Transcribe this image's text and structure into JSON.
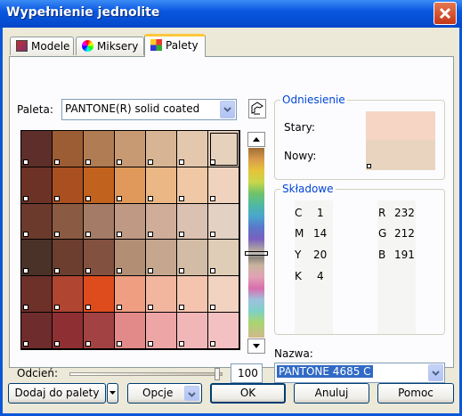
{
  "window": {
    "title": "Wypełnienie jednolite"
  },
  "tabs": [
    {
      "label": "Modele",
      "icon": "color-model-icon"
    },
    {
      "label": "Miksery",
      "icon": "color-wheel-icon"
    },
    {
      "label": "Palety",
      "icon": "palette-grid-icon",
      "active": true
    }
  ],
  "palette": {
    "label": "Paleta:",
    "selected": "PANTONE(R) solid coated"
  },
  "swatches": [
    [
      "#5e2f2a",
      "#9c5c34",
      "#b07c54",
      "#c89a74",
      "#d7b493",
      "#e3c8ad",
      "#e6d1bd"
    ],
    [
      "#6c3226",
      "#a94f20",
      "#c2621f",
      "#e0995a",
      "#ebb785",
      "#f0c8a5",
      "#efd3bf"
    ],
    [
      "#6b3a2c",
      "#8b5a42",
      "#a37b66",
      "#bf9984",
      "#cfad99",
      "#dbc1b1",
      "#e3d1c3"
    ],
    [
      "#4a3228",
      "#6b3e2f",
      "#83513f",
      "#b28e74",
      "#c4a78e",
      "#d3bca5",
      "#dfcdb8"
    ],
    [
      "#6d3129",
      "#b04531",
      "#de4c1d",
      "#ef9e81",
      "#f2b59e",
      "#f4c4af",
      "#f2d2c1"
    ],
    [
      "#6f2c2c",
      "#8e3033",
      "#a24243",
      "#e28989",
      "#eda5a6",
      "#f1b6b8",
      "#f3c1c1"
    ]
  ],
  "reference": {
    "title": "Odniesienie",
    "old_label": "Stary:",
    "new_label": "Nowy:",
    "old_color": "#f6d5c5",
    "new_color": "#e8d4bf"
  },
  "components": {
    "title": "Składowe",
    "cmyk": [
      {
        "label": "C",
        "value": "1"
      },
      {
        "label": "M",
        "value": "14"
      },
      {
        "label": "Y",
        "value": "20"
      },
      {
        "label": "K",
        "value": "4"
      }
    ],
    "rgb": [
      {
        "label": "R",
        "value": "232"
      },
      {
        "label": "G",
        "value": "212"
      },
      {
        "label": "B",
        "value": "191"
      }
    ]
  },
  "tint": {
    "label": "Odcień:",
    "value": "100",
    "fraction": 1.0
  },
  "name": {
    "label": "Nazwa:",
    "value": "PANTONE 4685 C"
  },
  "buttons": {
    "add_to_palette": "Dodaj do palety",
    "options": "Opcje",
    "ok": "OK",
    "cancel": "Anuluj",
    "help": "Pomoc"
  },
  "colors": {
    "title_bar": "#0a58e0",
    "dialog_bg": "#ece9d8",
    "tab_accent": "#ffc83c",
    "group_title": "#0046d5",
    "selection": "#316ac5"
  }
}
